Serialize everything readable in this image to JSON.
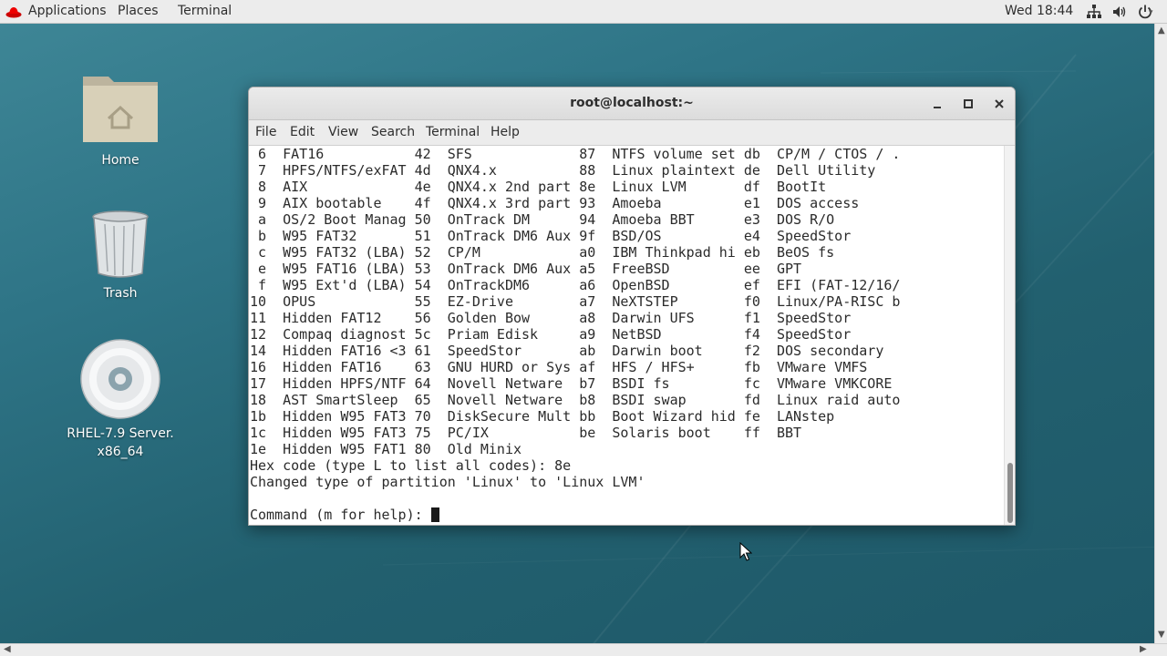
{
  "topbar": {
    "applications": "Applications",
    "places": "Places",
    "terminal": "Terminal",
    "clock": "Wed 18:44",
    "icons": [
      "network-icon",
      "volume-icon",
      "power-icon"
    ]
  },
  "desktop": {
    "home": "Home",
    "trash": "Trash",
    "disc_line1": "RHEL-7.9 Server.",
    "disc_line2": "x86_64"
  },
  "window": {
    "title": "root@localhost:~",
    "menu": [
      "File",
      "Edit",
      "View",
      "Search",
      "Terminal",
      "Help"
    ],
    "terminal_lines": [
      " 6  FAT16           42  SFS             87  NTFS volume set db  CP/M / CTOS / .",
      " 7  HPFS/NTFS/exFAT 4d  QNX4.x          88  Linux plaintext de  Dell Utility",
      " 8  AIX             4e  QNX4.x 2nd part 8e  Linux LVM       df  BootIt",
      " 9  AIX bootable    4f  QNX4.x 3rd part 93  Amoeba          e1  DOS access",
      " a  OS/2 Boot Manag 50  OnTrack DM      94  Amoeba BBT      e3  DOS R/O",
      " b  W95 FAT32       51  OnTrack DM6 Aux 9f  BSD/OS          e4  SpeedStor",
      " c  W95 FAT32 (LBA) 52  CP/M            a0  IBM Thinkpad hi eb  BeOS fs",
      " e  W95 FAT16 (LBA) 53  OnTrack DM6 Aux a5  FreeBSD         ee  GPT",
      " f  W95 Ext'd (LBA) 54  OnTrackDM6      a6  OpenBSD         ef  EFI (FAT-12/16/",
      "10  OPUS            55  EZ-Drive        a7  NeXTSTEP        f0  Linux/PA-RISC b",
      "11  Hidden FAT12    56  Golden Bow      a8  Darwin UFS      f1  SpeedStor",
      "12  Compaq diagnost 5c  Priam Edisk     a9  NetBSD          f4  SpeedStor",
      "14  Hidden FAT16 <3 61  SpeedStor       ab  Darwin boot     f2  DOS secondary",
      "16  Hidden FAT16    63  GNU HURD or Sys af  HFS / HFS+      fb  VMware VMFS",
      "17  Hidden HPFS/NTF 64  Novell Netware  b7  BSDI fs         fc  VMware VMKCORE",
      "18  AST SmartSleep  65  Novell Netware  b8  BSDI swap       fd  Linux raid auto",
      "1b  Hidden W95 FAT3 70  DiskSecure Mult bb  Boot Wizard hid fe  LANstep",
      "1c  Hidden W95 FAT3 75  PC/IX           be  Solaris boot    ff  BBT",
      "1e  Hidden W95 FAT1 80  Old Minix",
      "Hex code (type L to list all codes): 8e",
      "Changed type of partition 'Linux' to 'Linux LVM'",
      ""
    ],
    "prompt": "Command (m for help): "
  }
}
